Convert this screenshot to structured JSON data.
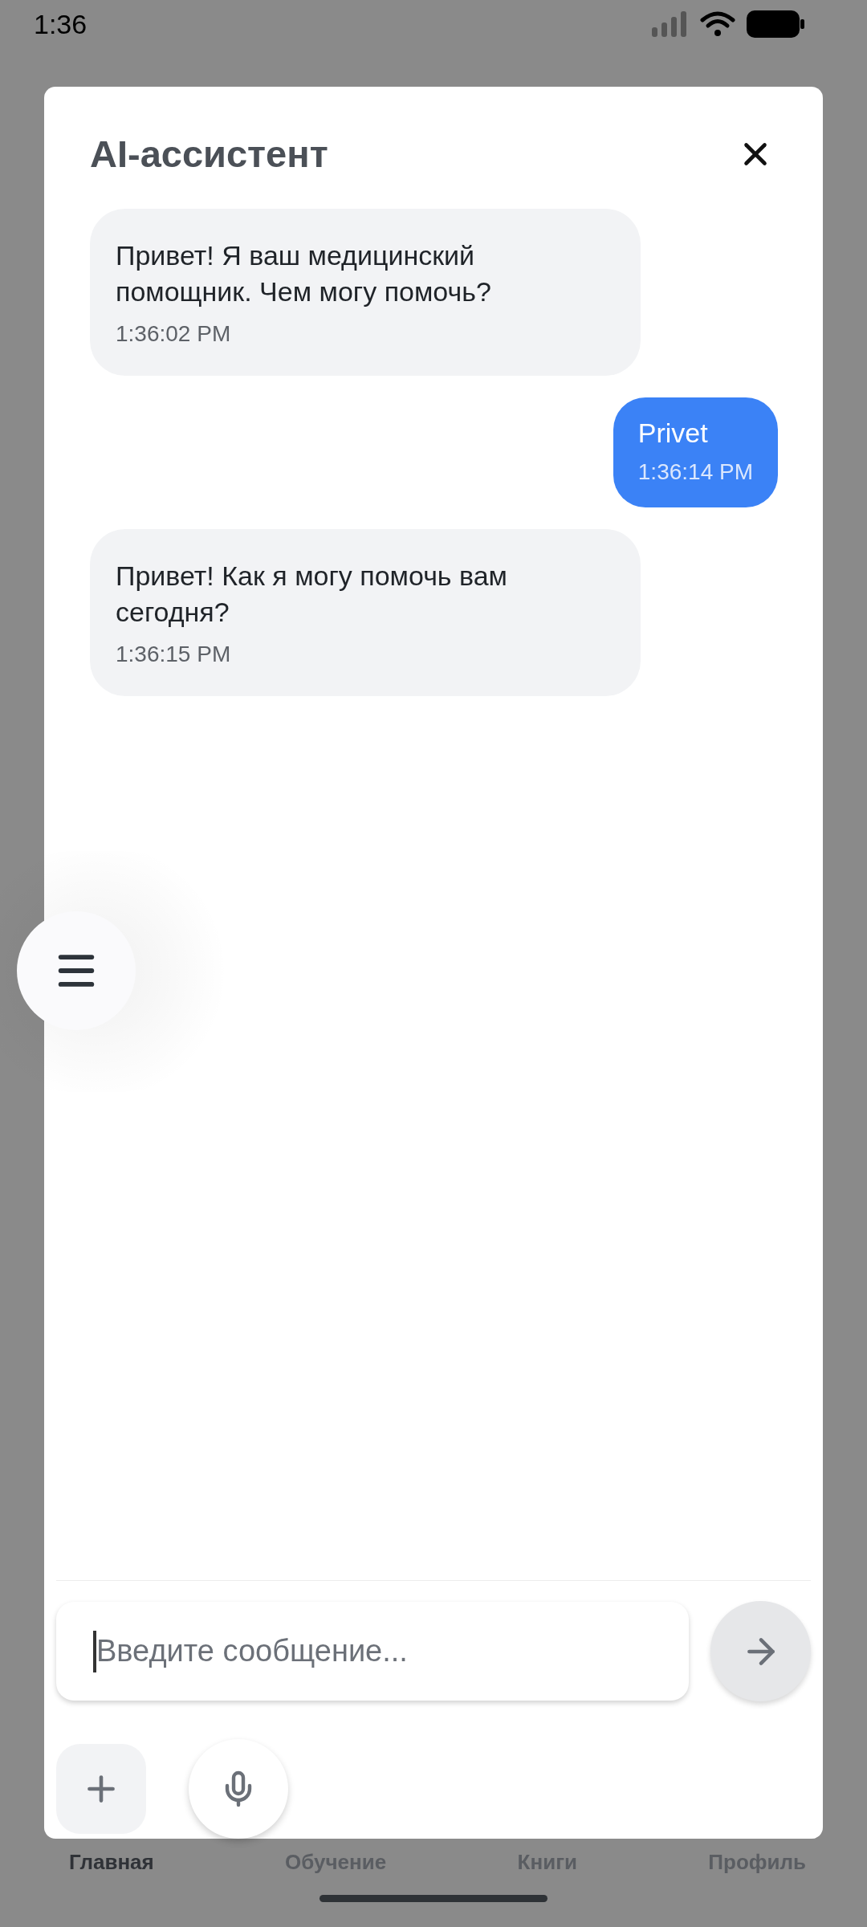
{
  "status_bar": {
    "time": "1:36"
  },
  "dialog": {
    "title": "AI-ассистент",
    "messages": [
      {
        "kind": "assistant",
        "text": "Привет! Я ваш медицинский помощник. Чем могу помочь?",
        "time": "1:36:02 PM"
      },
      {
        "kind": "user",
        "text": "Privet",
        "time": "1:36:14 PM"
      },
      {
        "kind": "assistant",
        "text": "Привет! Как я могу помочь вам сегодня?",
        "time": "1:36:15 PM"
      }
    ],
    "input": {
      "placeholder": "Введите сообщение..."
    }
  },
  "bottom_nav": [
    {
      "label": "Главная",
      "selected": true
    },
    {
      "label": "Обучение",
      "selected": false
    },
    {
      "label": "Книги",
      "selected": false
    },
    {
      "label": "Профиль",
      "selected": false
    }
  ]
}
